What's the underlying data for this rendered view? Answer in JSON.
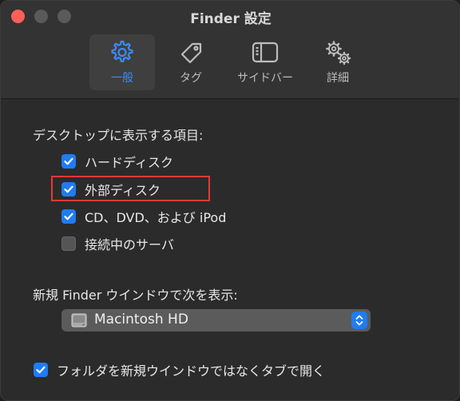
{
  "window": {
    "title": "Finder 設定"
  },
  "toolbar": {
    "items": [
      {
        "label": "一般",
        "icon": "gear-icon",
        "active": true
      },
      {
        "label": "タグ",
        "icon": "tag-icon",
        "active": false
      },
      {
        "label": "サイドバー",
        "icon": "sidebar-icon",
        "active": false
      },
      {
        "label": "詳細",
        "icon": "gears-icon",
        "active": false
      }
    ]
  },
  "desktop_section": {
    "heading": "デスクトップに表示する項目:",
    "options": [
      {
        "label": "ハードディスク",
        "checked": true
      },
      {
        "label": "外部ディスク",
        "checked": true
      },
      {
        "label": "CD、DVD、および iPod",
        "checked": true
      },
      {
        "label": "接続中のサーバ",
        "checked": false
      }
    ]
  },
  "new_window_section": {
    "heading": "新規 Finder ウインドウで次を表示:",
    "selected": "Macintosh HD"
  },
  "tabs_option": {
    "label": "フォルダを新規ウインドウではなくタブで開く",
    "checked": true
  },
  "colors": {
    "accent": "#1f7cf2",
    "highlight": "#e53935"
  }
}
